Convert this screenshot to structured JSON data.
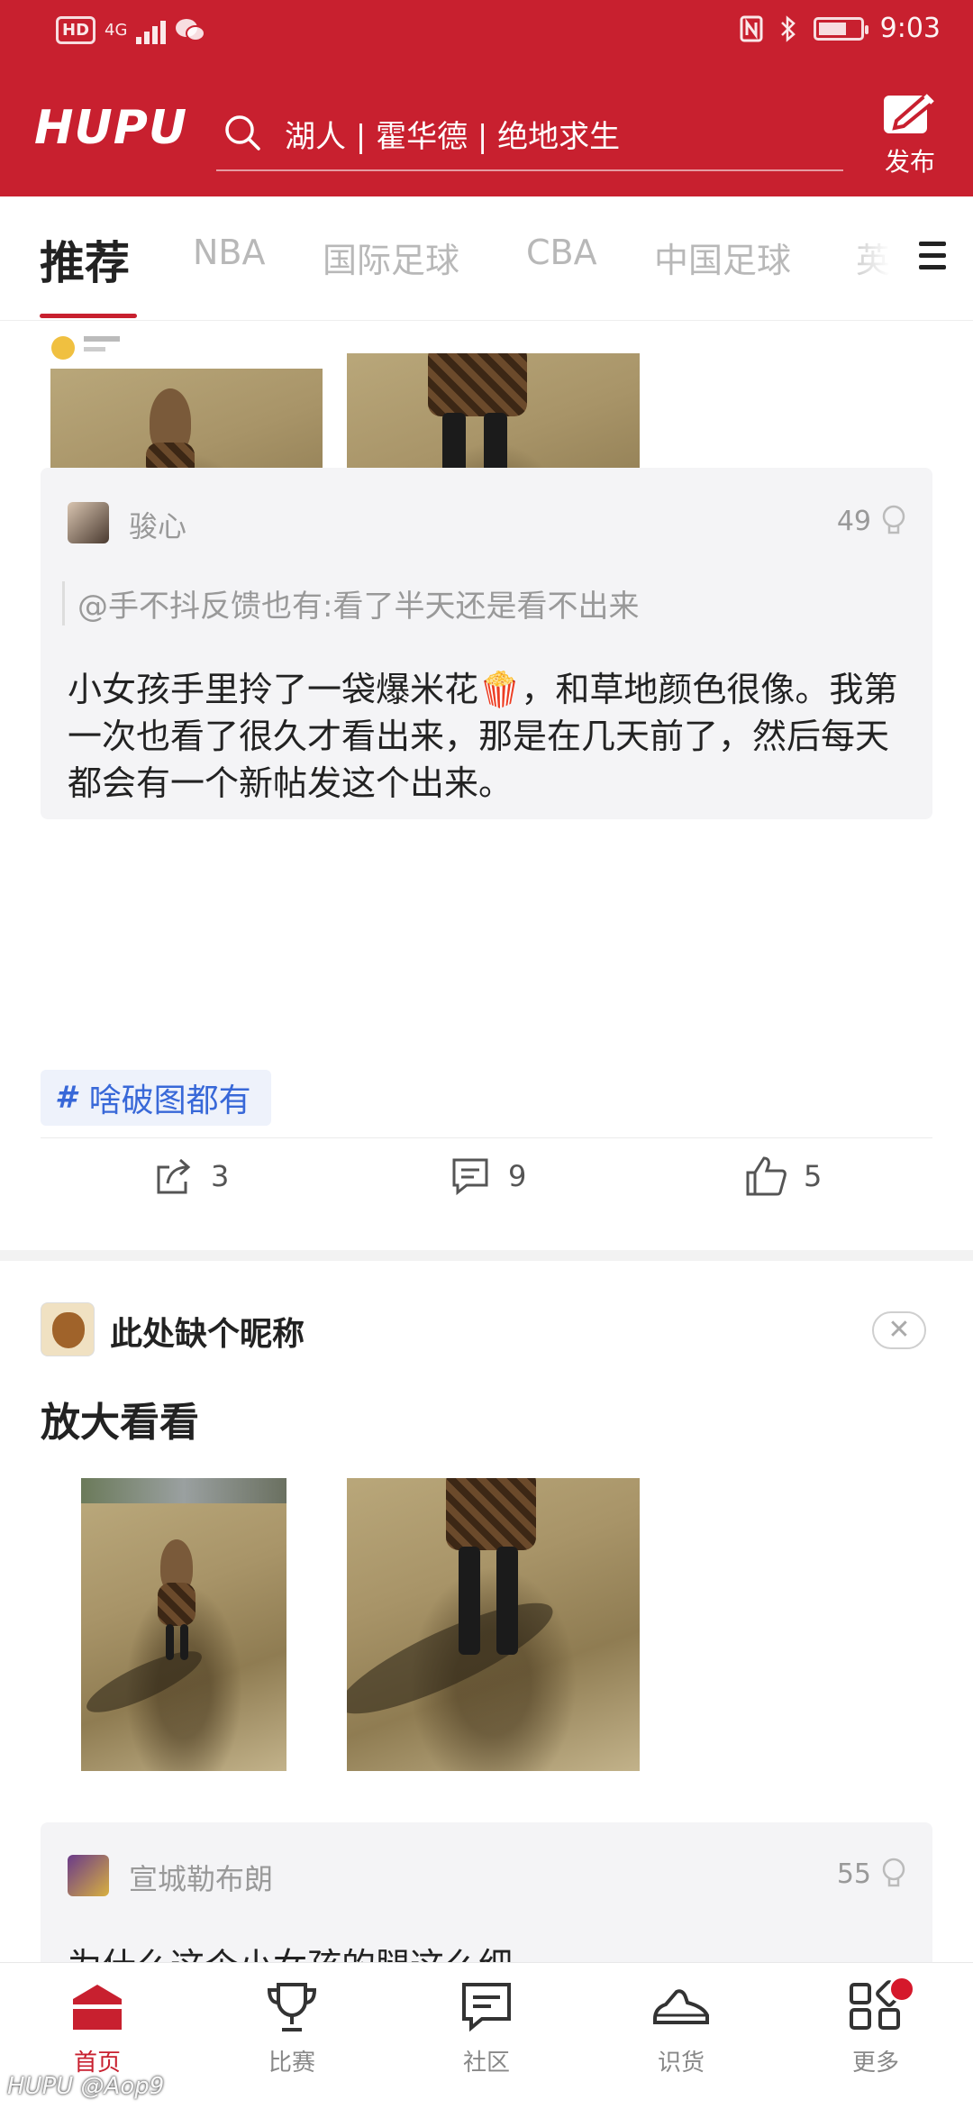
{
  "status_bar": {
    "network_badge": "HD",
    "network_type": "4G",
    "time": "9:03"
  },
  "header": {
    "logo": "HUPU",
    "search_placeholder": "湖人 | 霍华德 | 绝地求生",
    "publish_label": "发布"
  },
  "tabs": [
    {
      "label": "推荐",
      "active": true
    },
    {
      "label": "NBA"
    },
    {
      "label": "国际足球"
    },
    {
      "label": "CBA"
    },
    {
      "label": "中国足球"
    },
    {
      "label": "英"
    }
  ],
  "post1": {
    "comment": {
      "author": "骏心",
      "likes": "49",
      "quote": "@手不抖反馈也有:看了半天还是看不出来",
      "body": "小女孩手里拎了一袋爆米花🍿，和草地颜色很像。我第一次也看了很久才看出来，那是在几天前了，然后每天都会有一个新帖发这个出来。"
    },
    "tag": "啥破图都有",
    "actions": {
      "share": "3",
      "comment": "9",
      "like": "5"
    }
  },
  "post2": {
    "author": "此处缺个昵称",
    "title": "放大看看",
    "comment": {
      "author": "宣城勒布朗",
      "likes": "55",
      "body": "为什么这个小女孩的腿这么细"
    }
  },
  "bottom_nav": [
    {
      "label": "首页",
      "icon": "home-icon",
      "active": true
    },
    {
      "label": "比赛",
      "icon": "trophy-icon"
    },
    {
      "label": "社区",
      "icon": "chat-icon"
    },
    {
      "label": "识货",
      "icon": "sneaker-icon"
    },
    {
      "label": "更多",
      "icon": "grid-icon"
    }
  ],
  "watermark": "HUPU @Aop9",
  "colors": {
    "brand_red": "#c8202f",
    "tag_blue": "#3868d8"
  }
}
